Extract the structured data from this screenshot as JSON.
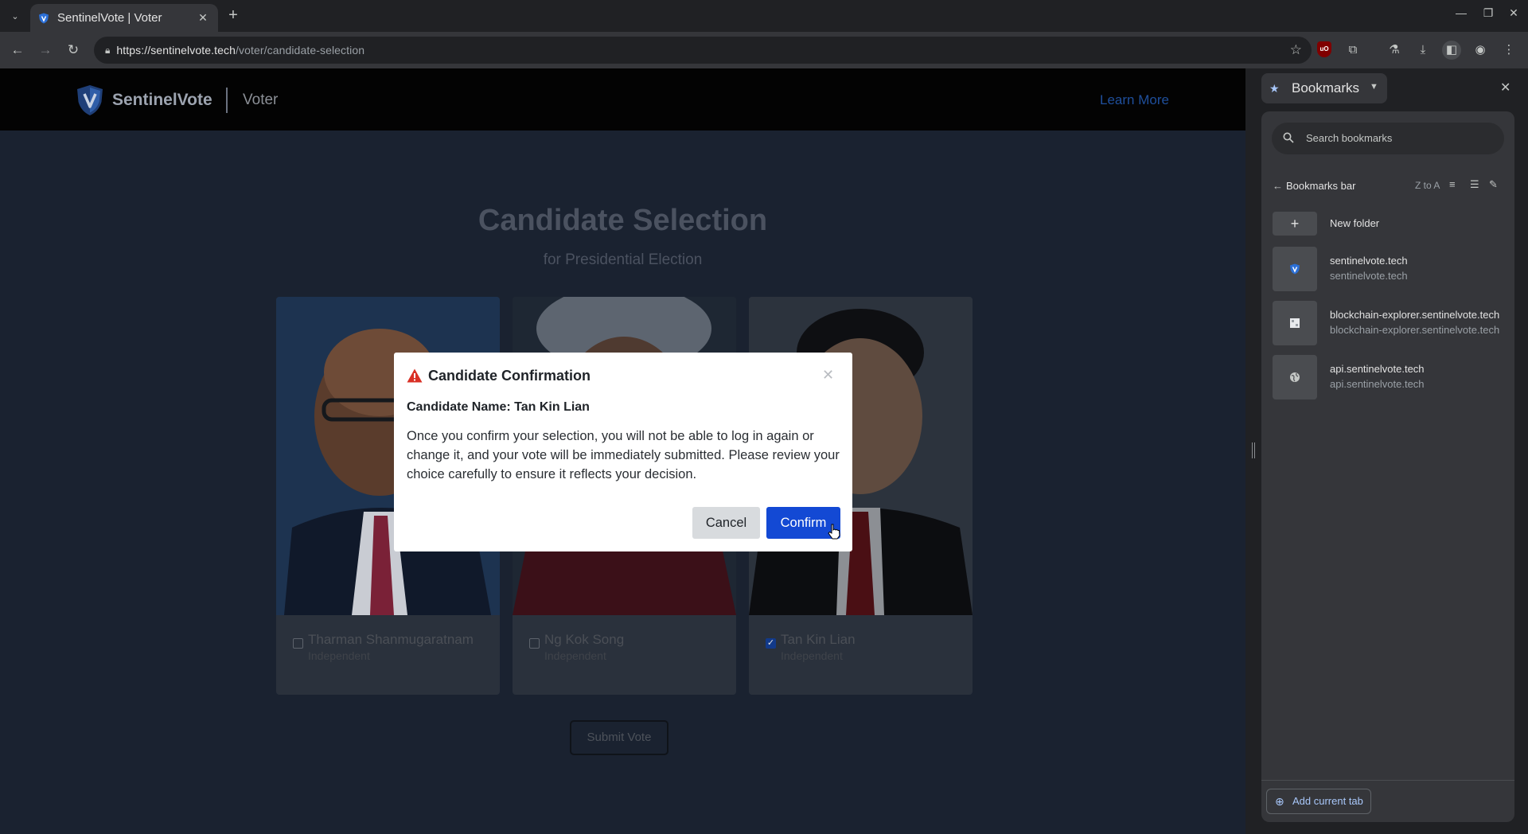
{
  "browser": {
    "tab_title": "SentinelVote | Voter",
    "url_domain": "https://sentinelvote.tech",
    "url_path": "/voter/candidate-selection"
  },
  "site": {
    "brand": "SentinelVote",
    "section": "Voter",
    "learn_more": "Learn More",
    "title": "Candidate Selection",
    "subtitle": "for Presidential Election",
    "submit_label": "Submit Vote"
  },
  "candidates": [
    {
      "name": "Tharman Shanmugaratnam",
      "party": "Independent",
      "checked": false
    },
    {
      "name": "Ng Kok Song",
      "party": "Independent",
      "checked": false
    },
    {
      "name": "Tan Kin Lian",
      "party": "Independent",
      "checked": true
    }
  ],
  "modal": {
    "title": "Candidate Confirmation",
    "candidate_line": "Candidate Name: Tan Kin Lian",
    "body": "Once you confirm your selection, you will not be able to log in again or change it, and your vote will be immediately submitted. Please review your choice carefully to ensure it reflects your decision.",
    "cancel_label": "Cancel",
    "confirm_label": "Confirm"
  },
  "bookmarks": {
    "panel_title": "Bookmarks",
    "search_placeholder": "Search bookmarks",
    "folder": "Bookmarks bar",
    "sort_label": "Z to A",
    "new_folder_label": "New folder",
    "items": [
      {
        "title": "sentinelvote.tech",
        "url": "sentinelvote.tech"
      },
      {
        "title": "blockchain-explorer.sentinelvote.tech",
        "url": "blockchain-explorer.sentinelvote.tech"
      },
      {
        "title": "api.sentinelvote.tech",
        "url": "api.sentinelvote.tech"
      }
    ],
    "add_current_tab": "Add current tab"
  }
}
